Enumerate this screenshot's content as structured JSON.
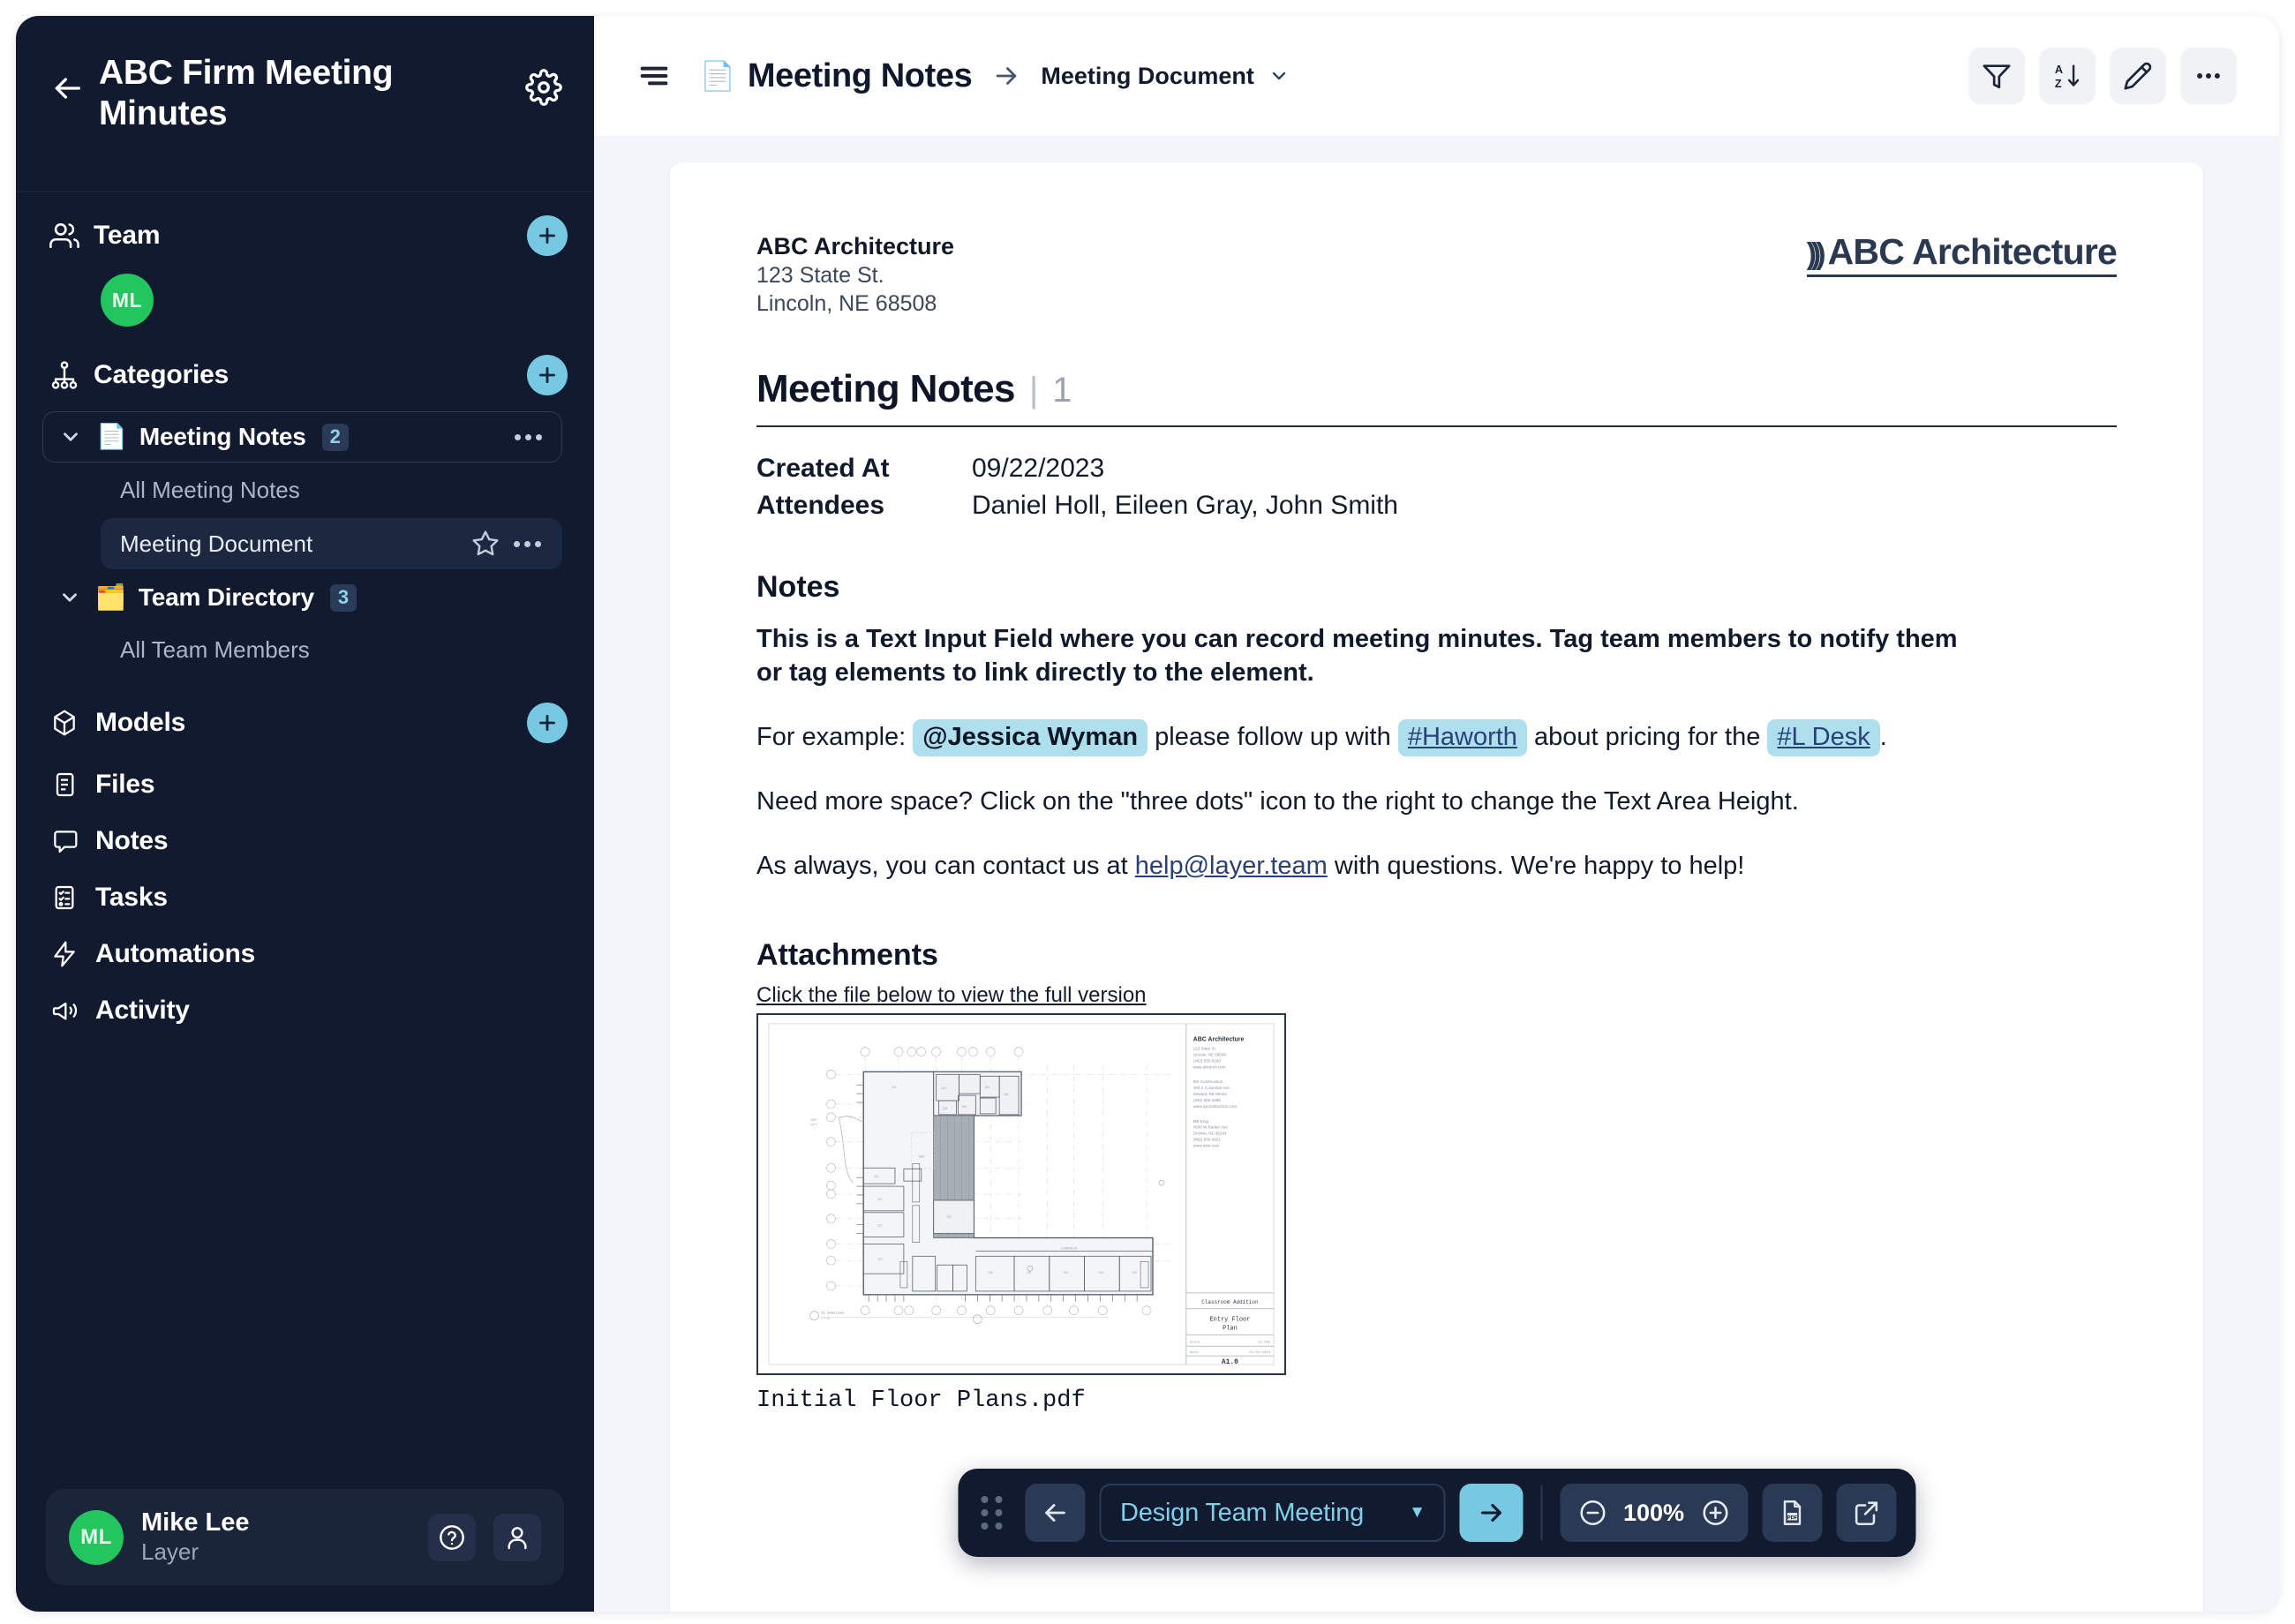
{
  "sidebar": {
    "title": "ABC Firm Meeting Minutes",
    "back_icon": "back-arrow-icon",
    "settings_icon": "gear-icon",
    "team": {
      "label": "Team",
      "add_label": "+",
      "members": [
        {
          "initials": "ML",
          "color": "#22c55e"
        }
      ]
    },
    "categories": {
      "label": "Categories",
      "add_label": "+",
      "groups": [
        {
          "emoji": "📄",
          "name": "Meeting Notes",
          "badge": "2",
          "expanded": true,
          "children": [
            {
              "label": "All Meeting Notes",
              "active": false,
              "starred": false
            },
            {
              "label": "Meeting Document",
              "active": true,
              "starred": true
            }
          ]
        },
        {
          "emoji": "🗂️",
          "name": "Team Directory",
          "badge": "3",
          "expanded": true,
          "children": [
            {
              "label": "All Team Members",
              "active": false,
              "starred": false
            }
          ]
        }
      ]
    },
    "nav": [
      {
        "label": "Models",
        "icon": "models-icon",
        "has_add": true
      },
      {
        "label": "Files",
        "icon": "files-icon",
        "has_add": false
      },
      {
        "label": "Notes",
        "icon": "notes-icon",
        "has_add": false
      },
      {
        "label": "Tasks",
        "icon": "tasks-icon",
        "has_add": false
      },
      {
        "label": "Automations",
        "icon": "automations-icon",
        "has_add": false
      },
      {
        "label": "Activity",
        "icon": "activity-icon",
        "has_add": false
      }
    ],
    "profile": {
      "initials": "ML",
      "name": "Mike Lee",
      "org": "Layer",
      "help_icon": "help-circle-icon",
      "account_icon": "user-icon"
    }
  },
  "topbar": {
    "menu_icon": "hamburger-menu-icon",
    "doc_emoji": "📄",
    "breadcrumb_main": "Meeting Notes",
    "breadcrumb_sub": "Meeting Document",
    "tools": [
      {
        "name": "filter-icon",
        "label": "Filter"
      },
      {
        "name": "sort-az-icon",
        "label": "Sort"
      },
      {
        "name": "edit-pencil-icon",
        "label": "Edit"
      },
      {
        "name": "more-options-icon",
        "label": "More"
      }
    ]
  },
  "document": {
    "firm_name": "ABC Architecture",
    "firm_address_1": "123 State St.",
    "firm_address_2": "Lincoln, NE 68508",
    "logo_text": "ABC Architecture",
    "title": "Meeting Notes",
    "number": "1",
    "meta": [
      {
        "key": "Created At",
        "value": "09/22/2023"
      },
      {
        "key": "Attendees",
        "value": "Daniel Holl, Eileen Gray, John Smith"
      }
    ],
    "notes_heading": "Notes",
    "notes_intro": "This is a Text Input Field where you can record meeting minutes. Tag team members to notify them or tag elements to link directly to the element.",
    "example": {
      "lead": "For example:",
      "mention": "@Jessica Wyman",
      "mid": "please follow up with",
      "tag1": "#Haworth",
      "mid2": "about pricing for the",
      "tag2": "#L Desk",
      "end": "."
    },
    "paragraph_space": "Need more space? Click on the \"three dots\" icon to the right to change the Text Area Height.",
    "contact_pre": "As always, you can contact us at",
    "contact_email": "help@layer.team",
    "contact_post": "with questions. We're happy to help!",
    "attachments_heading": "Attachments",
    "attachments_hint": "Click the file below to view the full version",
    "attachment_file": "Initial Floor Plans.pdf",
    "attachment_titleblock": {
      "firm": "ABC Architecture",
      "project": "Classroom Addition",
      "sheet_title": "Entry Floor Plan",
      "sheet_number": "A1.0"
    }
  },
  "floatbar": {
    "grip_icon": "drag-handle-icon",
    "prev_icon": "arrow-left-icon",
    "selected_meeting": "Design Team Meeting",
    "chevron_icon": "chevron-down-icon",
    "next_icon": "arrow-right-icon",
    "zoom_out_icon": "zoom-out-icon",
    "zoom_level": "100%",
    "zoom_in_icon": "zoom-in-icon",
    "pdf_icon": "pdf-export-icon",
    "open_external_icon": "open-external-icon"
  },
  "colors": {
    "sidebar_bg": "#111a2e",
    "accent_blue": "#76c8e3",
    "avatar_green": "#22c55e",
    "tag_highlight": "#aedfec",
    "canvas_bg": "#f2f6fa"
  }
}
